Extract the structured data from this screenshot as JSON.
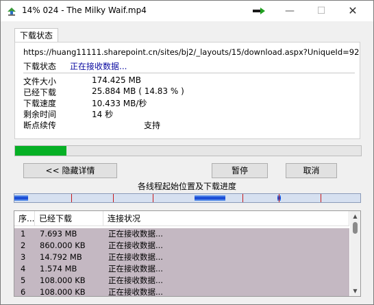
{
  "window": {
    "title": "14% 024 - The Milky Waif.mp4",
    "min_glyph": "—",
    "max_glyph": "☐",
    "close_glyph": "✕",
    "icons": {
      "app": "download-app-icon",
      "title_extra": "arrow-icon"
    }
  },
  "tab": {
    "label": "下载状态"
  },
  "info": {
    "url": "https://huang11111.sharepoint.cn/sites/bj2/_layouts/15/download.aspx?UniqueId=92",
    "status_label": "下载状态",
    "status_value": "正在接收数据...",
    "rows": [
      {
        "label": "文件大小",
        "value": "174.425  MB"
      },
      {
        "label": "已经下载",
        "value": "25.884  MB  ( 14.83 % )"
      },
      {
        "label": "下载速度",
        "value": "10.433  MB/秒"
      },
      {
        "label": "剩余时间",
        "value": "14 秒"
      },
      {
        "label": "断点续传",
        "value": "支持"
      }
    ]
  },
  "progress": {
    "percent": 14.83,
    "color": "#06b025"
  },
  "buttons": {
    "hide": "<< 隐藏详情",
    "pause": "暂停",
    "cancel": "取消"
  },
  "threads": {
    "title": "各线程起始位置及下载进度",
    "segments": [
      {
        "start": 0.0,
        "end": 0.04
      },
      {
        "start": 0.52,
        "end": 0.61
      },
      {
        "start": 0.76,
        "end": 0.77
      }
    ],
    "ticks": [
      0.165,
      0.285,
      0.4,
      0.66,
      0.765,
      0.885
    ],
    "colors": {
      "fill": "#0a3ad0",
      "tick": "#c81818"
    }
  },
  "list": {
    "columns": [
      "序...",
      "已经下载",
      "连接状况"
    ],
    "rows": [
      {
        "no": "1",
        "downloaded": "7.693  MB",
        "status": "正在接收数据..."
      },
      {
        "no": "2",
        "downloaded": "860.000  KB",
        "status": "正在接收数据..."
      },
      {
        "no": "3",
        "downloaded": "14.792  MB",
        "status": "正在接收数据..."
      },
      {
        "no": "4",
        "downloaded": "1.574  MB",
        "status": "正在接收数据..."
      },
      {
        "no": "5",
        "downloaded": "108.000  KB",
        "status": "正在接收数据..."
      },
      {
        "no": "6",
        "downloaded": "108.000  KB",
        "status": "正在接收数据..."
      }
    ],
    "row_color": "#c4b8c2"
  }
}
